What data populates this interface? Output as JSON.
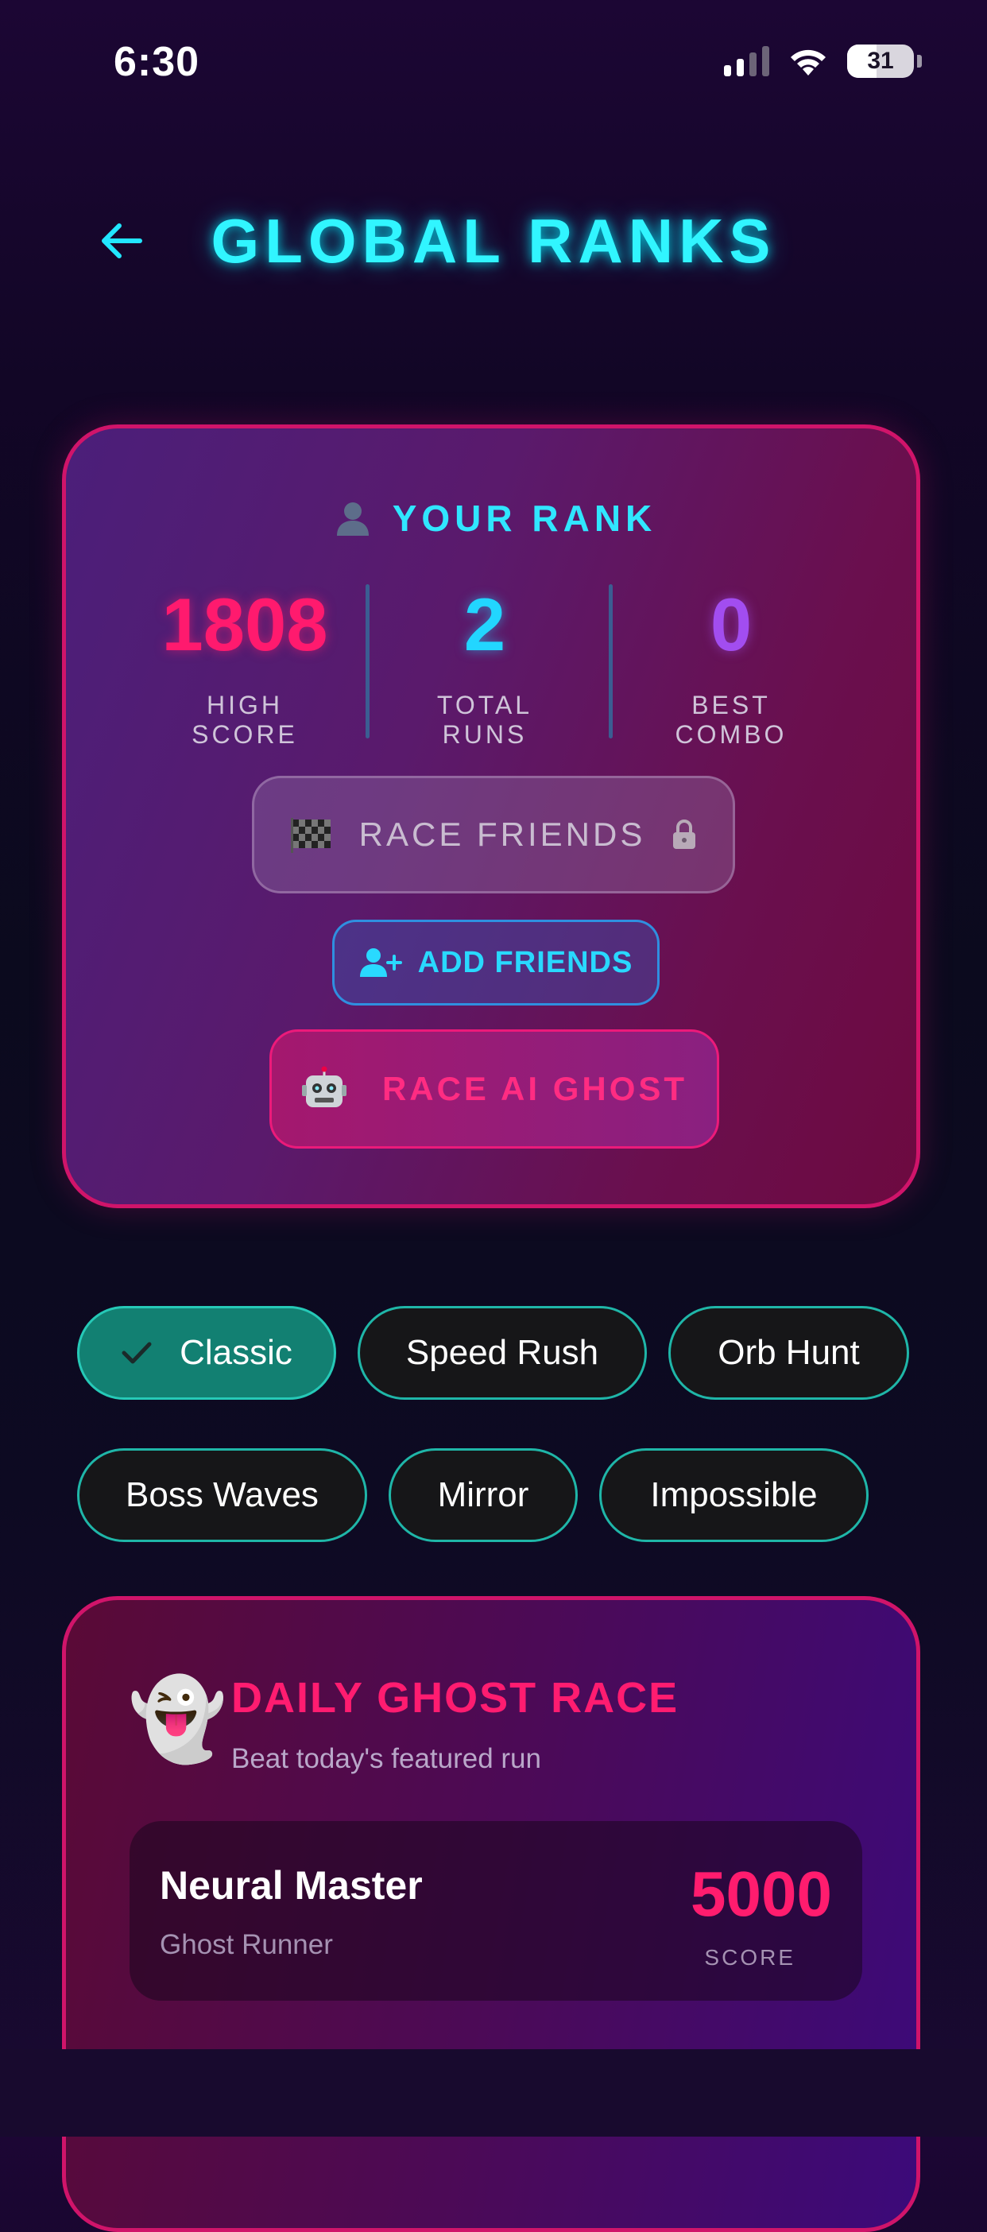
{
  "status_bar": {
    "time": "6:30",
    "battery": "31"
  },
  "header": {
    "title": "GLOBAL RANKS"
  },
  "rank_card": {
    "label": "YOUR RANK",
    "stats": [
      {
        "value": "1808",
        "label": "HIGH SCORE",
        "color": "#ff1a6e"
      },
      {
        "value": "2",
        "label": "TOTAL RUNS",
        "color": "#22d6ff"
      },
      {
        "value": "0",
        "label": "BEST COMBO",
        "color": "#a24df0"
      }
    ],
    "race_friends_label": "RACE FRIENDS",
    "add_friends_label": "ADD FRIENDS",
    "race_ai_ghost_label": "RACE AI GHOST"
  },
  "modes": [
    {
      "label": "Classic",
      "selected": true
    },
    {
      "label": "Speed Rush",
      "selected": false
    },
    {
      "label": "Orb Hunt",
      "selected": false
    },
    {
      "label": "Boss Waves",
      "selected": false
    },
    {
      "label": "Mirror",
      "selected": false
    },
    {
      "label": "Impossible",
      "selected": false
    }
  ],
  "daily_ghost": {
    "emoji": "👻",
    "title": "DAILY GHOST RACE",
    "subtitle": "Beat today's featured run",
    "runner_name": "Neural Master",
    "runner_role": "Ghost Runner",
    "score": "5000",
    "score_label": "SCORE"
  },
  "colors": {
    "accent_cyan": "#31f5ff",
    "accent_pink": "#ff1c70",
    "chip_border": "#1fb6a8"
  }
}
